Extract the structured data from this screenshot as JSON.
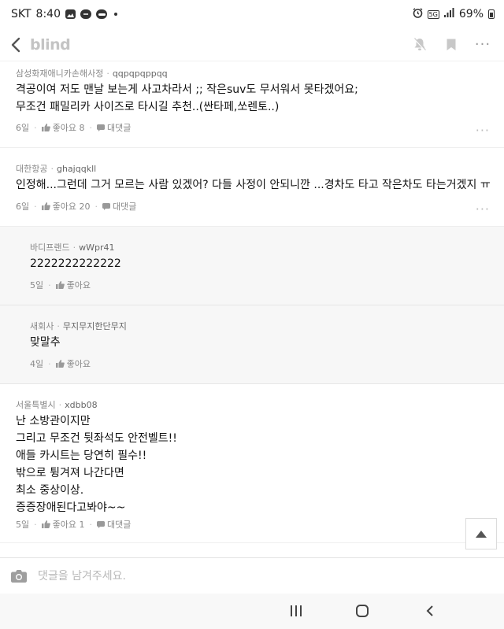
{
  "status_bar": {
    "carrier": "SKT",
    "time": "8:40",
    "battery": "69%",
    "network": "5G",
    "icons": [
      "gallery-icon",
      "chat-icon",
      "pay-icon",
      "dot-icon",
      "alarm-icon",
      "signal-icon",
      "battery-icon"
    ]
  },
  "header": {
    "logo": "blind",
    "icons": [
      "back-icon",
      "bell-off-icon",
      "bookmark-icon",
      "more-icon"
    ]
  },
  "comments": [
    {
      "company": "삼성화재애니카손해사정",
      "nick": "qqpqpqppqq",
      "lines": [
        "격공이여 저도 맨날 보는게 사고차라서 ;; 작은suv도 무서워서 못타겠어요;",
        "무조건 패밀리카 사이즈로 타시길 추천..(싼타페,쏘렌토..)"
      ],
      "date": "6일",
      "like_label": "좋아요 8",
      "reply_label": "대댓글"
    },
    {
      "company": "대한항공",
      "nick": "ghajqqkll",
      "lines": [
        "인정해...그런데 그거 모르는 사람 있겠어? 다들 사정이 안되니깐 ...경차도 타고 작은차도 타는거겠지 ㅠ"
      ],
      "date": "6일",
      "like_label": "좋아요 20",
      "reply_label": "대댓글"
    }
  ],
  "replies": [
    {
      "company": "바디프랜드",
      "nick": "wWpr41",
      "lines": [
        "2222222222222"
      ],
      "date": "5일",
      "like_label": "좋아요"
    },
    {
      "company": "새회사",
      "nick": "무지무지한단무지",
      "lines": [
        "맞말추"
      ],
      "date": "4일",
      "like_label": "좋아요"
    }
  ],
  "last_comment": {
    "company": "서울특별시",
    "nick": "xdbb08",
    "lines": [
      "난 소방관이지만",
      "그리고 무조건 뒷좌석도 안전벨트!!",
      "애들 카시트는 당연히 필수!!",
      "밖으로 튕겨져 나간다면",
      "최소 중상이상.",
      "증증장애된다고봐야~~"
    ],
    "date": "5일",
    "like_label": "좋아요 1",
    "reply_label": "대댓글"
  },
  "input": {
    "placeholder": "댓글을 남겨주세요."
  },
  "nav": {
    "icons": [
      "recent-apps-icon",
      "home-icon",
      "back-nav-icon"
    ]
  },
  "colors": {
    "logo": "#c4c4c4",
    "reply_bg": "#f7f7f7",
    "meta_text": "#777777"
  }
}
